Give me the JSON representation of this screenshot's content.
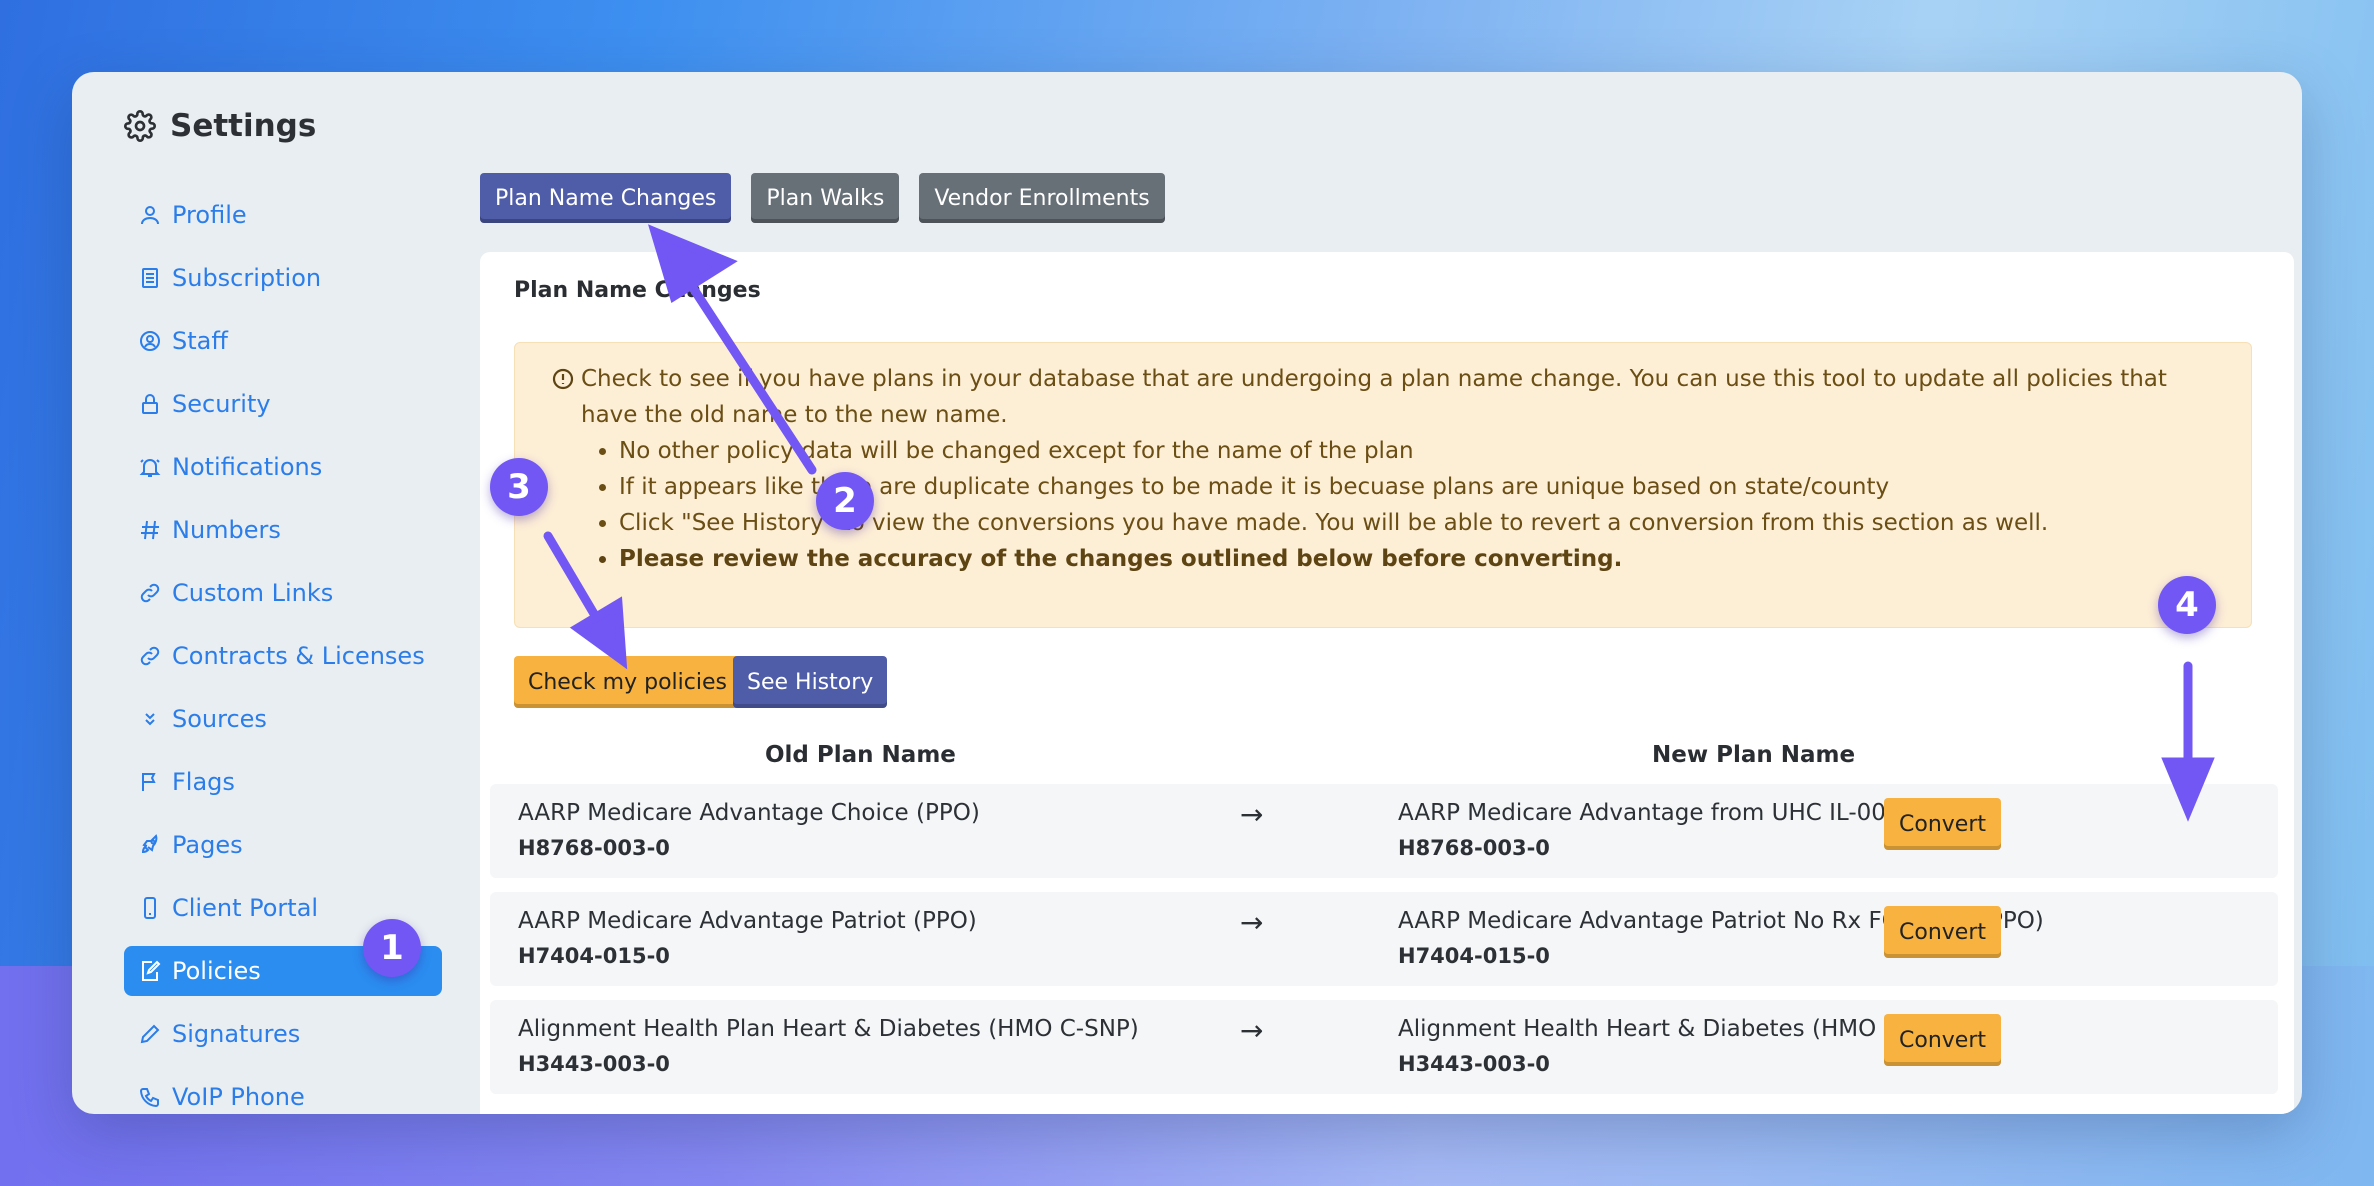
{
  "window": {
    "title": "Settings"
  },
  "sidebar": {
    "items": [
      {
        "label": "Profile",
        "icon": "user-icon"
      },
      {
        "label": "Subscription",
        "icon": "document-icon"
      },
      {
        "label": "Staff",
        "icon": "user-circle-icon"
      },
      {
        "label": "Security",
        "icon": "lock-icon"
      },
      {
        "label": "Notifications",
        "icon": "bell-icon"
      },
      {
        "label": "Numbers",
        "icon": "hash-icon"
      },
      {
        "label": "Custom Links",
        "icon": "link-icon"
      },
      {
        "label": "Contracts & Licenses",
        "icon": "link-icon"
      },
      {
        "label": "Sources",
        "icon": "chevrons-down-icon"
      },
      {
        "label": "Flags",
        "icon": "flag-icon"
      },
      {
        "label": "Pages",
        "icon": "rocket-icon"
      },
      {
        "label": "Client Portal",
        "icon": "phone-icon"
      },
      {
        "label": "Policies",
        "icon": "edit-document-icon",
        "active": true
      },
      {
        "label": "Signatures",
        "icon": "pen-icon"
      },
      {
        "label": "VoIP Phone",
        "icon": "phone-icon"
      }
    ]
  },
  "tabs": [
    {
      "label": "Plan Name Changes",
      "active": true
    },
    {
      "label": "Plan Walks"
    },
    {
      "label": "Vendor Enrollments"
    }
  ],
  "card": {
    "title": "Plan Name Changes",
    "alert": {
      "lead": "Check to see if you have plans in your database that are undergoing a plan name change. You can use this tool to update all policies that have the old name to the new name.",
      "bullets": [
        "No other policy data will be changed except for the name of the plan",
        "If it appears like there are duplicate changes to be made it is becuase plans are unique based on state/county",
        "Click \"See History\" to view the conversions you have made. You will be able to revert a conversion from this section as well."
      ],
      "emphasis": "Please review the accuracy of the changes outlined below before converting."
    },
    "check_button": "Check my policies",
    "history_button": "See History",
    "columns": {
      "old": "Old Plan Name",
      "new": "New Plan Name"
    },
    "rows": [
      {
        "old_name": "AARP Medicare Advantage Choice (PPO)",
        "old_code": "H8768-003-0",
        "new_name": "AARP Medicare Advantage from UHC IL-0003 (PPO)",
        "new_code": "H8768-003-0",
        "action": "Convert"
      },
      {
        "old_name": "AARP Medicare Advantage Patriot (PPO)",
        "old_code": "H7404-015-0",
        "new_name": "AARP Medicare Advantage Patriot No Rx FG-MA01 (PPO)",
        "new_code": "H7404-015-0",
        "action": "Convert"
      },
      {
        "old_name": "Alignment Health Plan Heart & Diabetes (HMO C-SNP)",
        "old_code": "H3443-003-0",
        "new_name": "Alignment Health Heart & Diabetes (HMO C-SNP)",
        "new_code": "H3443-003-0",
        "action": "Convert"
      }
    ]
  },
  "markers": [
    "1",
    "2",
    "3",
    "4"
  ],
  "colors": {
    "accent": "#2b8df0",
    "primary_tab": "#4f5ca8",
    "warning": "#f7b23f",
    "marker": "#7257f5"
  }
}
